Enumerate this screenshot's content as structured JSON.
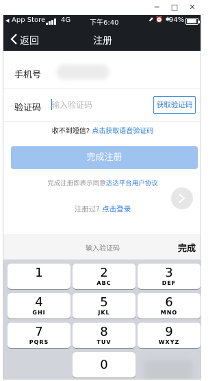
{
  "window": {
    "minimize": "─",
    "maximize": "□",
    "close": "✕"
  },
  "status_bar": {
    "back_app": "App Store",
    "network": "4G",
    "time": "下午6:40",
    "icons": "⬈ ⏰ ✱",
    "battery": "94%",
    "battery_level": 0.94
  },
  "nav": {
    "back_label": "返回",
    "title": "注册"
  },
  "form": {
    "phone_label": "手机号",
    "code_label": "验证码",
    "code_placeholder": "输入验证码",
    "get_code_button": "获取验证码"
  },
  "voice": {
    "prefix": "收不到短信?",
    "link": "点击获取语音验证码"
  },
  "submit_button": "完成注册",
  "agreement": {
    "prefix": "完成注册即表示同意",
    "link": "达达平台用户协议"
  },
  "login": {
    "prefix": "注册过?",
    "link": "点击登录"
  },
  "keyboard": {
    "hint": "输入验证码",
    "done": "完成",
    "keys": [
      {
        "digit": "1",
        "letters": ""
      },
      {
        "digit": "2",
        "letters": "ABC"
      },
      {
        "digit": "3",
        "letters": "DEF"
      },
      {
        "digit": "4",
        "letters": "GHI"
      },
      {
        "digit": "5",
        "letters": "JKL"
      },
      {
        "digit": "6",
        "letters": "MNO"
      },
      {
        "digit": "7",
        "letters": "PQRS"
      },
      {
        "digit": "8",
        "letters": "TUV"
      },
      {
        "digit": "9",
        "letters": "WXYZ"
      },
      {
        "digit": "0",
        "letters": ""
      }
    ]
  },
  "colors": {
    "nav_bg": "#1b1f24",
    "link": "#2f7ce0",
    "submit_bg": "#9ec3f0",
    "keyboard_bg": "#d1d4da"
  }
}
